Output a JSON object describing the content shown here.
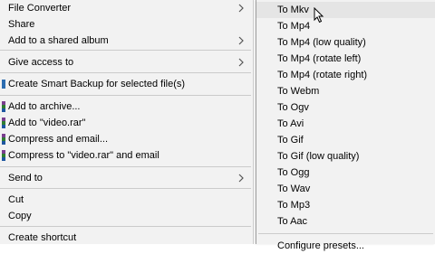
{
  "main_menu": {
    "items": [
      {
        "label": "File Converter",
        "has_submenu": true
      },
      {
        "label": "Share"
      },
      {
        "label": "Add to a shared album",
        "has_submenu": true
      },
      {
        "label": "Give access to",
        "has_submenu": true
      },
      {
        "label": "Create Smart Backup for selected file(s)"
      },
      {
        "label": "Add to archive..."
      },
      {
        "label": "Add to \"video.rar\""
      },
      {
        "label": "Compress and email..."
      },
      {
        "label": "Compress to \"video.rar\" and email"
      },
      {
        "label": "Send to",
        "has_submenu": true
      },
      {
        "label": "Cut"
      },
      {
        "label": "Copy"
      },
      {
        "label": "Create shortcut"
      }
    ]
  },
  "sub_menu": {
    "items": [
      {
        "label": "To Mkv"
      },
      {
        "label": "To Mp4"
      },
      {
        "label": "To Mp4 (low quality)"
      },
      {
        "label": "To Mp4 (rotate left)"
      },
      {
        "label": "To Mp4 (rotate right)"
      },
      {
        "label": "To Webm"
      },
      {
        "label": "To Ogv"
      },
      {
        "label": "To Avi"
      },
      {
        "label": "To Gif"
      },
      {
        "label": "To Gif (low quality)"
      },
      {
        "label": "To Ogg"
      },
      {
        "label": "To Wav"
      },
      {
        "label": "To Mp3"
      },
      {
        "label": "To Aac"
      }
    ],
    "partial_bottom_label": "Configure presets..."
  },
  "icons": {
    "submenu_arrow": "chevron-right-icon",
    "backup": "backup-icon",
    "archive": "winrar-icon",
    "cursor": "mouse-pointer-icon"
  },
  "colors": {
    "menu_background": "#f2f2f2",
    "hover_background": "#e5e5e5",
    "separator": "#cbcbcb"
  }
}
